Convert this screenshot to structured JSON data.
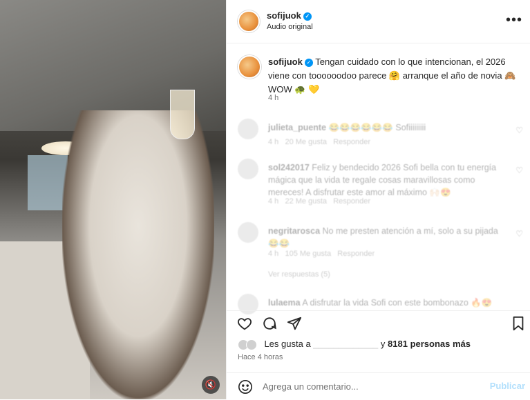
{
  "post": {
    "username": "sofijuok",
    "audio_label": "Audio original",
    "more_icon": "more-horizontal-icon",
    "caption_username": "sofijuok",
    "caption_text": "Tengan cuidado con lo que intencionan, el 2026 viene con toooooodoo parece 🤗 arranque el año de novia 🙈 WOW 🐢 💛",
    "caption_time": "4 h"
  },
  "comments": [
    {
      "user": "julieta_puente",
      "text": "😂😂😂😂😂😂 Sofiiiiiiiii",
      "time": "4 h",
      "likes": "20 Me gusta",
      "reply": "Responder"
    },
    {
      "user": "sol242017",
      "text": "Feliz y bendecido 2026 Sofi bella con tu energía mágica que la vida te regale cosas maravillosas como mereces! A disfrutar este amor al máximo 🙌🏻😍",
      "time": "4 h",
      "likes": "22 Me gusta",
      "reply": "Responder"
    },
    {
      "user": "negritarosca",
      "text": "No me presten atención a mí, solo a su pijada 😂😂",
      "time": "4 h",
      "likes": "105 Me gusta",
      "reply": "Responder",
      "replies": "Ver respuestas (5)"
    },
    {
      "user": "lulaema",
      "text": "A disfrutar la vida Sofi con este bombonazo 🔥😍",
      "time": "",
      "likes": "",
      "reply": ""
    }
  ],
  "actions": {
    "like_icon": "heart-icon",
    "comment_icon": "comment-icon",
    "share_icon": "share-icon",
    "save_icon": "bookmark-icon"
  },
  "likes": {
    "prefix": "Les gusta a",
    "user": "_____________",
    "suffix": "y",
    "count": "8181 personas más"
  },
  "time_ago": "Hace 4 horas",
  "composer": {
    "placeholder": "Agrega un comentario...",
    "post_label": "Publicar",
    "emoji_icon": "emoji-icon"
  },
  "media": {
    "mute_icon": "muted-speaker-icon"
  },
  "colors": {
    "accent": "#0095f6",
    "text": "#262626",
    "secondary": "#737373",
    "post_disabled": "#b2dffc"
  }
}
